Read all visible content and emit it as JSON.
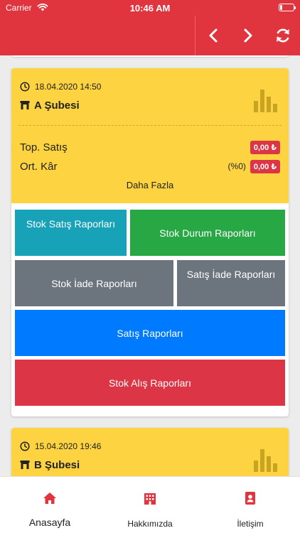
{
  "status": {
    "carrier": "Carrier",
    "time": "10:46 AM"
  },
  "colors": {
    "brand_red": "#e0343f",
    "card_yellow": "#fdd341"
  },
  "nav": {
    "prev_icon": "chevron-left-icon",
    "next_icon": "chevron-right-icon",
    "refresh_icon": "refresh-icon"
  },
  "branches": [
    {
      "datetime": "18.04.2020 14:50",
      "name": "A Şubesi",
      "total_sales_label": "Top. Satış",
      "total_sales_value": "0,00 ₺",
      "avg_profit_label": "Ort. Kâr",
      "avg_profit_percent": "(%0)",
      "avg_profit_value": "0,00 ₺",
      "more_label": "Daha Fazla",
      "reports": {
        "stock_sales": "Stok Satış Raporları",
        "stock_status": "Stok Durum Raporları",
        "stock_return": "Stok İade Raporları",
        "sales_return": "Satış İade Raporları",
        "sales": "Satış Raporları",
        "stock_purchase": "Stok Alış Raporları"
      }
    },
    {
      "datetime": "15.04.2020 19:46",
      "name": "B Şubesi"
    }
  ],
  "tabs": [
    {
      "label": "Anasayfa",
      "icon": "home-icon"
    },
    {
      "label": "Hakkımızda",
      "icon": "building-icon"
    },
    {
      "label": "İletişim",
      "icon": "contact-card-icon"
    }
  ]
}
